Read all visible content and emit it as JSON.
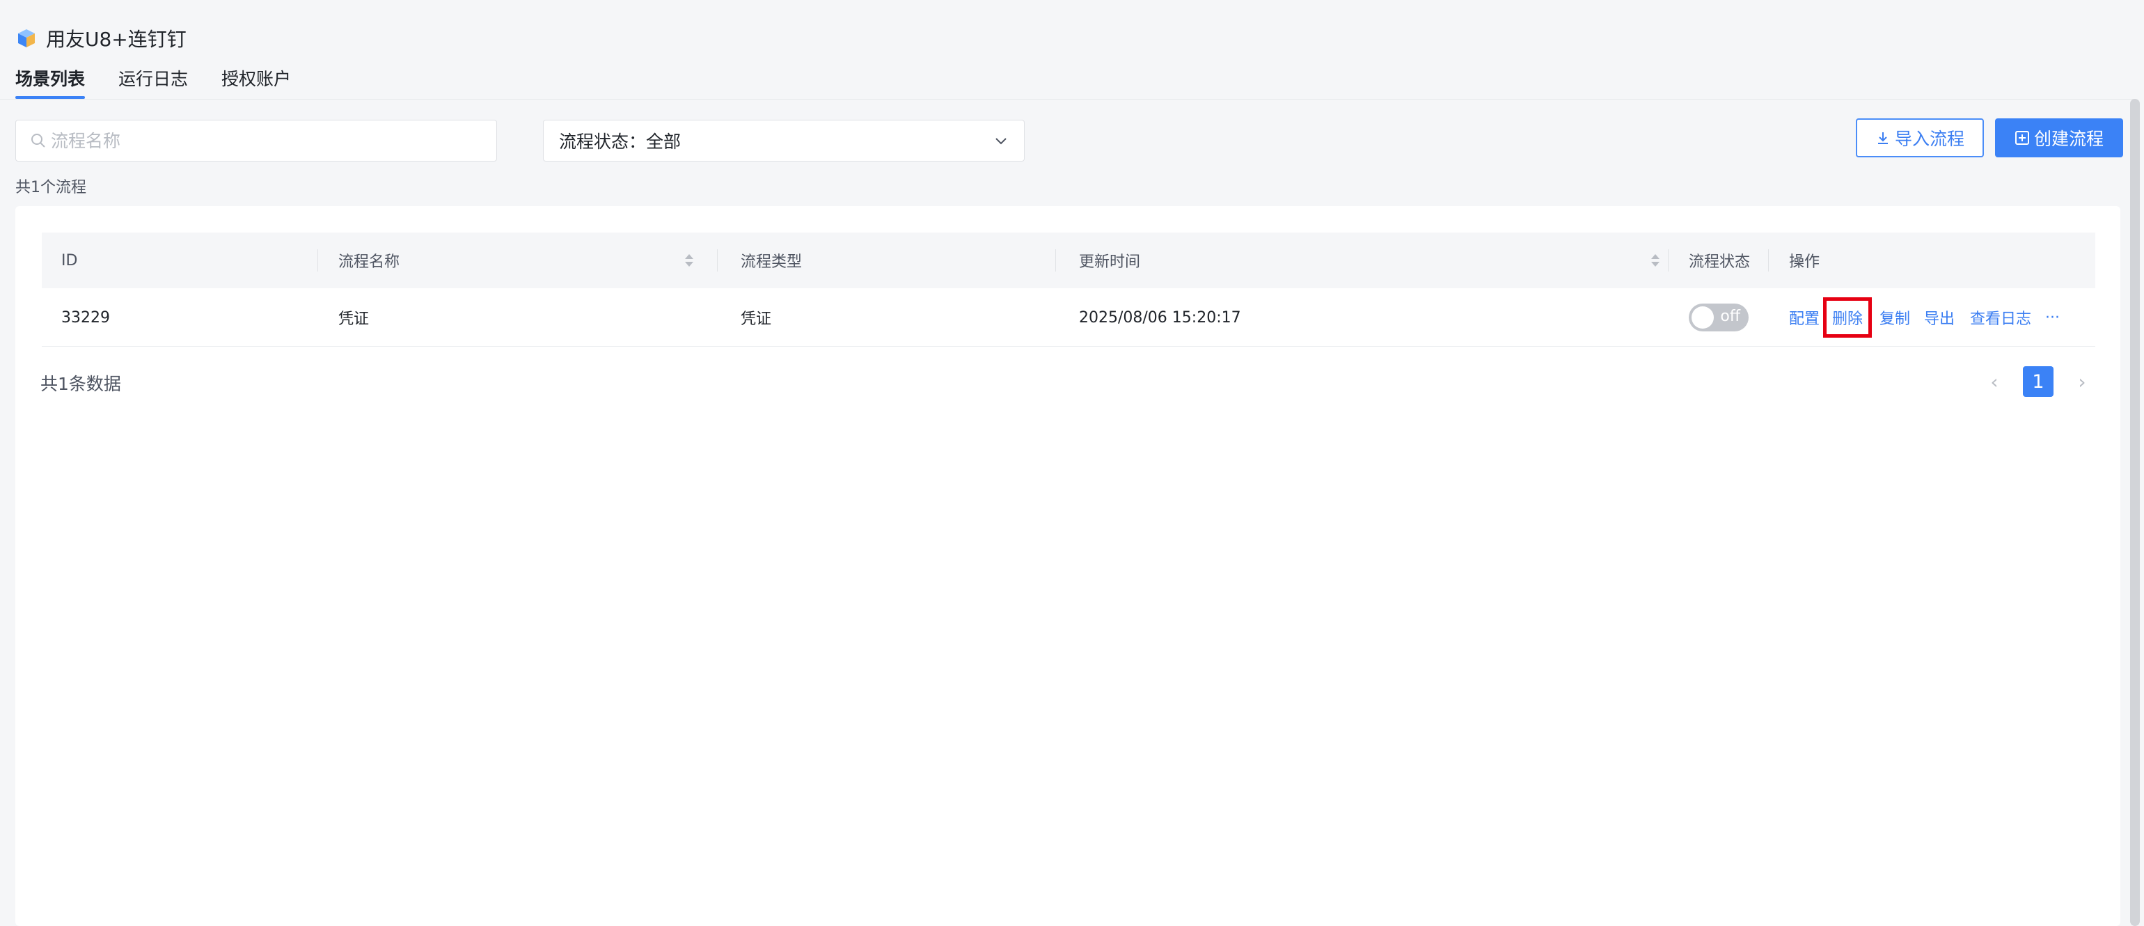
{
  "app": {
    "title": "用友U8+连钉钉",
    "logo_icon": "cube-logo-icon"
  },
  "tabs": [
    {
      "label": "场景列表",
      "active": true
    },
    {
      "label": "运行日志",
      "active": false
    },
    {
      "label": "授权账户",
      "active": false
    }
  ],
  "filters": {
    "search": {
      "placeholder": "流程名称",
      "value": ""
    },
    "status_select": {
      "label": "流程状态：",
      "selected": "全部"
    }
  },
  "buttons": {
    "import_label": "导入流程",
    "create_label": "创建流程"
  },
  "summary": {
    "count_text": "共1个流程"
  },
  "table": {
    "columns": [
      {
        "label": "ID",
        "sortable": false
      },
      {
        "label": "流程名称",
        "sortable": true
      },
      {
        "label": "流程类型",
        "sortable": false
      },
      {
        "label": "更新时间",
        "sortable": true
      },
      {
        "label": "流程状态",
        "sortable": false
      },
      {
        "label": "操作",
        "sortable": false
      }
    ],
    "rows": [
      {
        "id": "33229",
        "name": "凭证",
        "type": "凭证",
        "updated": "2025/08/06 15:20:17",
        "status_label": "off",
        "status_on": false,
        "actions": [
          "配置",
          "删除",
          "复制",
          "导出",
          "查看日志",
          "···"
        ]
      }
    ]
  },
  "footer": {
    "total_text": "共1条数据",
    "current_page": "1",
    "prev": "‹",
    "next": "›"
  },
  "colors": {
    "accent": "#3b82f6",
    "highlight_box": "#e60012",
    "toggle_off": "#c3c6cc"
  }
}
